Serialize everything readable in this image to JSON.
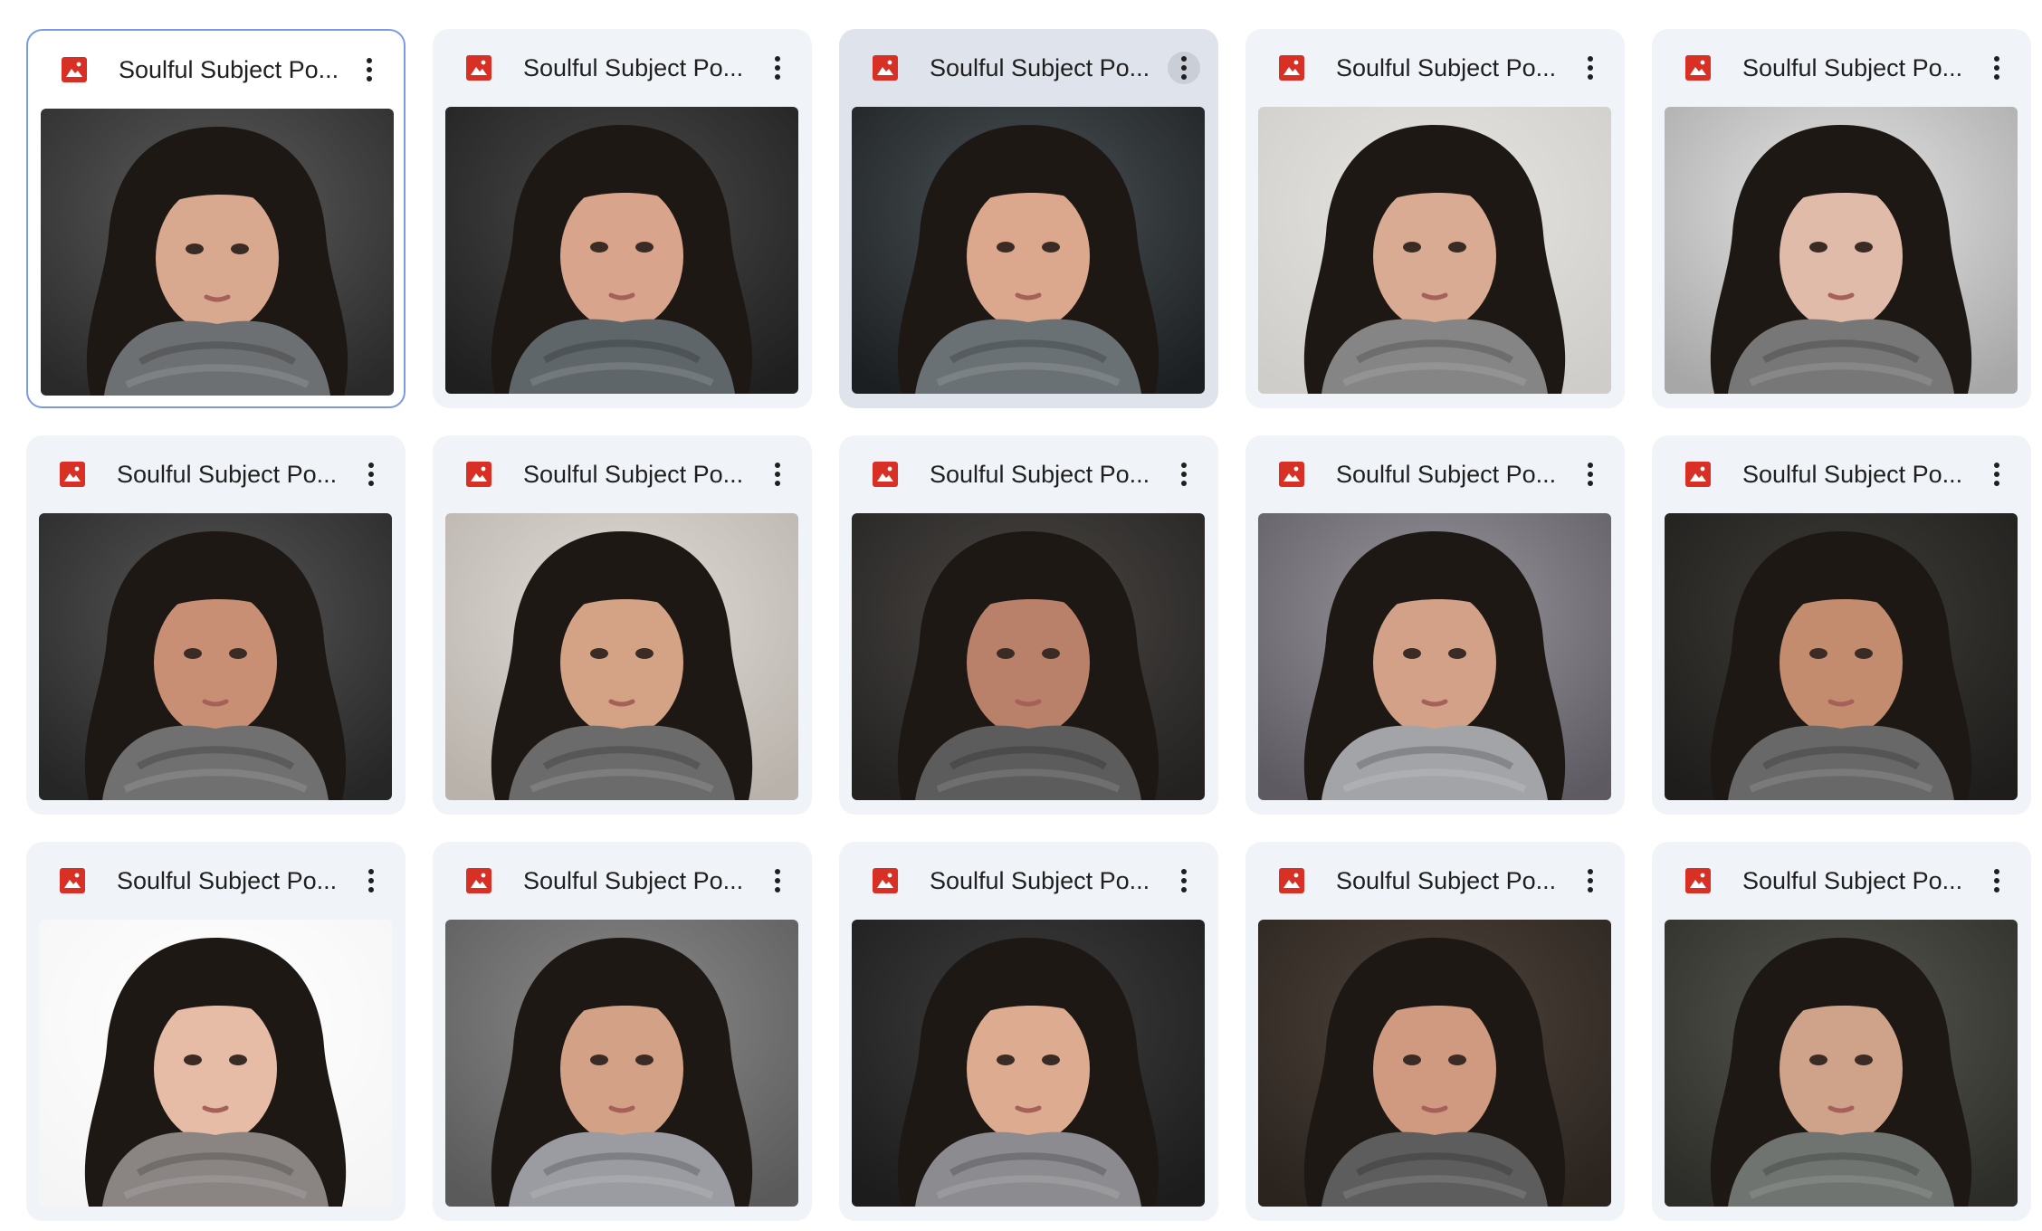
{
  "colors": {
    "card_bg": "#f0f4f9",
    "selected_border": "#7a9ae6",
    "hover_bg": "#dfe3eb",
    "icon_red": "#d93025",
    "title_text": "#1f1f1f"
  },
  "file_icon": "image-file-icon",
  "more_icon": "more-vert-icon",
  "files": [
    {
      "title": "Soulful Subject Po...",
      "bg": "#5c5c5c",
      "bg2": "#2a2a2a",
      "scarf": "#6d7072",
      "skin": "#d9a98f",
      "state": "selected"
    },
    {
      "title": "Soulful Subject Po...",
      "bg": "#4a4a4a",
      "bg2": "#1f1f1f",
      "scarf": "#5f6669",
      "skin": "#d8a58c",
      "state": "normal"
    },
    {
      "title": "Soulful Subject Po...",
      "bg": "#4b5256",
      "bg2": "#1c1f21",
      "scarf": "#6a7174",
      "skin": "#dba88d",
      "state": "hovered"
    },
    {
      "title": "Soulful Subject Po...",
      "bg": "#e7e5e2",
      "bg2": "#cfcdc9",
      "scarf": "#858585",
      "skin": "#d9ab93",
      "state": "normal"
    },
    {
      "title": "Soulful Subject Po...",
      "bg": "#e6e6e6",
      "bg2": "#a7a7a7",
      "scarf": "#777777",
      "skin": "#e1bba9",
      "state": "normal"
    },
    {
      "title": "Soulful Subject Po...",
      "bg": "#575757",
      "bg2": "#262626",
      "scarf": "#707070",
      "skin": "#c98f74",
      "state": "normal"
    },
    {
      "title": "Soulful Subject Po...",
      "bg": "#e1dcd6",
      "bg2": "#b8b2ab",
      "scarf": "#6b6b6b",
      "skin": "#d4a285",
      "state": "normal"
    },
    {
      "title": "Soulful Subject Po...",
      "bg": "#4a4744",
      "bg2": "#242221",
      "scarf": "#5c5c5c",
      "skin": "#b9816a",
      "state": "normal"
    },
    {
      "title": "Soulful Subject Po...",
      "bg": "#9a979d",
      "bg2": "#5d5a62",
      "scarf": "#a3a4a8",
      "skin": "#d3a187",
      "state": "normal"
    },
    {
      "title": "Soulful Subject Po...",
      "bg": "#3f3d39",
      "bg2": "#1e1d1b",
      "scarf": "#686868",
      "skin": "#c48c6e",
      "state": "normal"
    },
    {
      "title": "Soulful Subject Po...",
      "bg": "#ffffff",
      "bg2": "#f5f5f5",
      "scarf": "#8a8583",
      "skin": "#e6bca6",
      "state": "normal"
    },
    {
      "title": "Soulful Subject Po...",
      "bg": "#8b8b8b",
      "bg2": "#5a5a5a",
      "scarf": "#9a9ca1",
      "skin": "#d3a186",
      "state": "normal"
    },
    {
      "title": "Soulful Subject Po...",
      "bg": "#3e3e3e",
      "bg2": "#1c1c1c",
      "scarf": "#8c8c90",
      "skin": "#dcab90",
      "state": "normal"
    },
    {
      "title": "Soulful Subject Po...",
      "bg": "#4e443b",
      "bg2": "#2a231e",
      "scarf": "#5d5d5d",
      "skin": "#cf9a80",
      "state": "normal"
    },
    {
      "title": "Soulful Subject Po...",
      "bg": "#56584f",
      "bg2": "#2c2d28",
      "scarf": "#6f7470",
      "skin": "#cfa28a",
      "state": "normal"
    }
  ]
}
